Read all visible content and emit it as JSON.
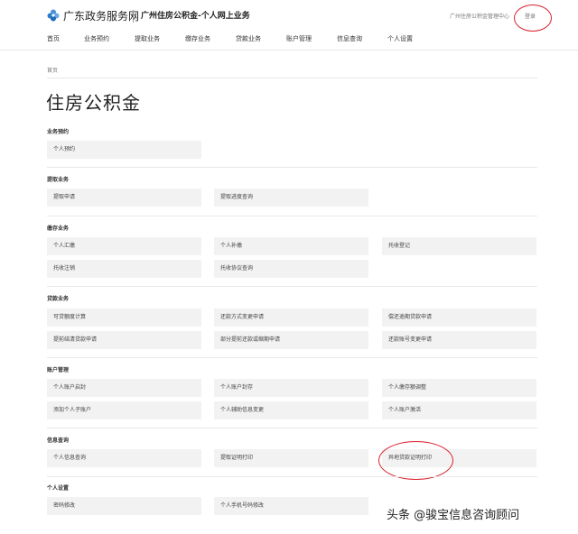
{
  "header": {
    "brand": "广东政务服务网",
    "site_title": "广州住房公积金-个人网上业务",
    "center_link": "广州住房公积金管理中心",
    "login": "登录",
    "logo_icon": "flower-logo-icon",
    "accent_color": "#2b7ccc"
  },
  "nav": [
    "首页",
    "业务预约",
    "提取业务",
    "缴存业务",
    "贷款业务",
    "账户管理",
    "信息查询",
    "个人设置"
  ],
  "breadcrumb": "首页",
  "page_title": "住房公积金",
  "sections": [
    {
      "title": "业务预约",
      "items": [
        "个人预约"
      ]
    },
    {
      "title": "提取业务",
      "items": [
        "提取申请",
        "提取进度查询"
      ]
    },
    {
      "title": "缴存业务",
      "items": [
        "个人汇缴",
        "个人补缴",
        "托收登记",
        "托收注销",
        "托收协议查询"
      ]
    },
    {
      "title": "贷款业务",
      "items": [
        "可贷额度计算",
        "还款方式变更申请",
        "偿还逾期贷款申请",
        "提前结清贷款申请",
        "部分提前还款或缩期申请",
        "还款账号变更申请"
      ]
    },
    {
      "title": "账户管理",
      "items": [
        "个人账户启封",
        "个人账户封存",
        "个人缴存额调整",
        "添加个人子账户",
        "个人辅助信息变更",
        "个人账户激活"
      ]
    },
    {
      "title": "信息查询",
      "items": [
        "个人信息查询",
        "提取证明打印",
        "异地贷款证明打印"
      ]
    },
    {
      "title": "个人设置",
      "items": [
        "密码修改",
        "个人手机号码修改"
      ]
    }
  ],
  "watermark": "头条 @骏宝信息咨询顾问",
  "annotation_color": "#d9232e"
}
